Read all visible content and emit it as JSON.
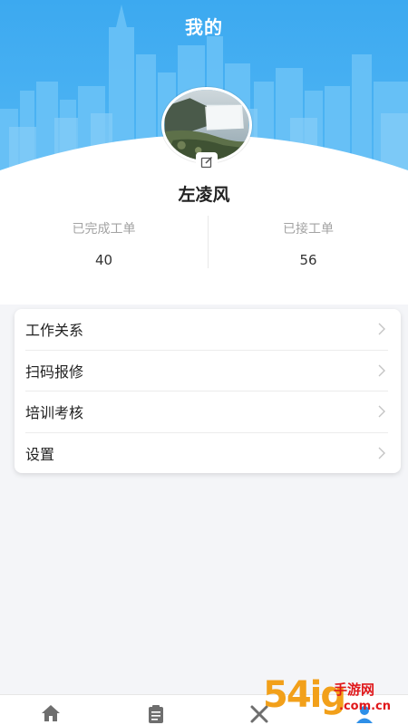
{
  "header": {
    "title": "我的"
  },
  "profile": {
    "name": "左凌风"
  },
  "stats": [
    {
      "label": "已完成工单",
      "value": "40"
    },
    {
      "label": "已接工单",
      "value": "56"
    }
  ],
  "menu": [
    {
      "label": "工作关系"
    },
    {
      "label": "扫码报修"
    },
    {
      "label": "培训考核"
    },
    {
      "label": "设置"
    }
  ],
  "tabbar": [
    "home-icon",
    "orders-icon",
    "repair-icon",
    "me-icon"
  ],
  "watermark": {
    "number": "54ig",
    "site": "手游网",
    "domain": ".com.cn"
  },
  "colors": {
    "header_blue": "#45b0f2",
    "chevron": "#c4c4c4",
    "watermark_orange": "#f2a01a",
    "watermark_red": "#e0181b"
  }
}
